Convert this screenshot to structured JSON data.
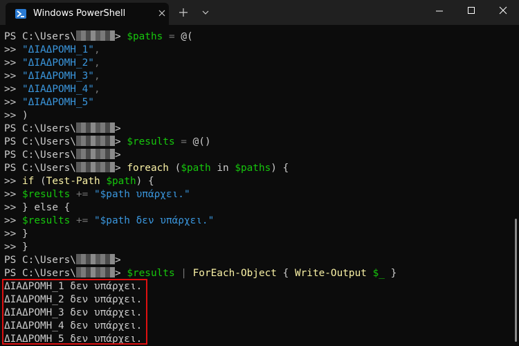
{
  "tab": {
    "title": "Windows PowerShell"
  },
  "prompt": {
    "prefix": "PS C:\\Users\\",
    "suffix": ">"
  },
  "continuation": ">>",
  "code": {
    "l1": "$paths",
    "l1_eq": "=",
    "l1_rest": "@(",
    "s1": "\"ΔΙΑΔΡΟΜΗ_1\"",
    "s2": "\"ΔΙΑΔΡΟΜΗ_2\"",
    "s3": "\"ΔΙΑΔΡΟΜΗ_3\"",
    "s4": "\"ΔΙΑΔΡΟΜΗ_4\"",
    "s5": "\"ΔΙΑΔΡΟΜΗ_5\"",
    "comma": ",",
    "close_paren": ")",
    "results_var": "$results",
    "results_init": "@()",
    "foreach_kw": "foreach",
    "foreach_open": "(",
    "path_var": "$path",
    "in_kw": "in",
    "paths_var": "$paths",
    "foreach_close": ") {",
    "if_kw": "if",
    "if_open": "(",
    "test_path": "Test-Path",
    "if_close": ") {",
    "plus_eq": "+=",
    "str_exists": "\"$path υπάρχει.\"",
    "else_line": "} else {",
    "str_not_exists": "\"$path δεν υπάρχει.\"",
    "close_brace": "}",
    "pipe": "|",
    "foreach_object": "ForEach-Object",
    "open_brace": "{",
    "write_output": "Write-Output",
    "underscore_var": "$_"
  },
  "output": [
    "ΔΙΑΔΡΟΜΗ_1 δεν υπάρχει.",
    "ΔΙΑΔΡΟΜΗ_2 δεν υπάρχει.",
    "ΔΙΑΔΡΟΜΗ_3 δεν υπάρχει.",
    "ΔΙΑΔΡΟΜΗ_4 δεν υπάρχει.",
    "ΔΙΑΔΡΟΜΗ_5 δεν υπάρχει."
  ],
  "colors": {
    "variable": "#16c60c",
    "string": "#3a96dd",
    "command": "#f9f1a5",
    "highlight": "#e01010"
  }
}
